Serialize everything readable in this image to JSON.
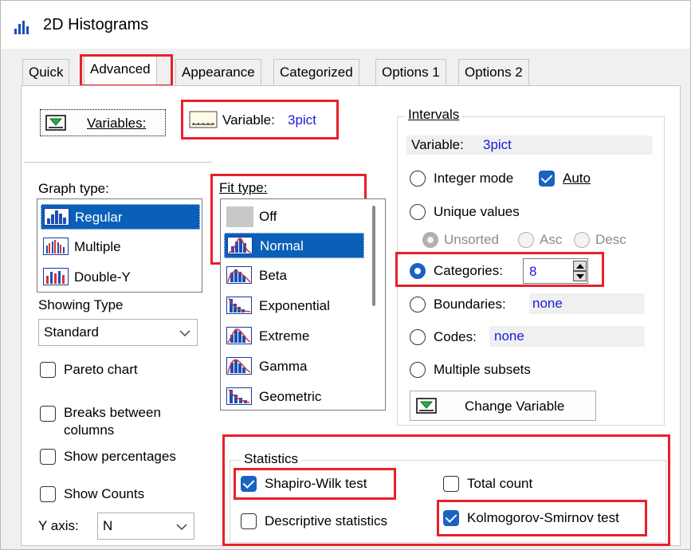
{
  "window": {
    "title": "2D Histograms",
    "icon": "histogram-app-icon"
  },
  "tabs": [
    "Quick",
    "Advanced",
    "Appearance",
    "Categorized",
    "Options 1",
    "Options 2"
  ],
  "active_tab": "Advanced",
  "variables_button": {
    "label": "Variables:",
    "icon": "green-arrow-icon"
  },
  "variable_display": {
    "label": "Variable:",
    "value": "3pict"
  },
  "graph_type": {
    "label": "Graph type:",
    "items": [
      {
        "label": "Regular",
        "selected": true
      },
      {
        "label": "Multiple",
        "selected": false
      },
      {
        "label": "Double-Y",
        "selected": false
      }
    ]
  },
  "showing_type": {
    "label": "Showing Type",
    "value": "Standard"
  },
  "checks_left": {
    "pareto": {
      "label": "Pareto chart",
      "checked": false
    },
    "breaks": {
      "label": "Breaks between",
      "label2": "columns",
      "checked": false
    },
    "percentages": {
      "label": "Show percentages",
      "checked": false
    },
    "counts": {
      "label": "Show Counts",
      "checked": false
    }
  },
  "y_axis": {
    "label": "Y axis:",
    "value": "N"
  },
  "fit_type": {
    "label": "Fit type:",
    "items": [
      {
        "label": "Off",
        "selected": false
      },
      {
        "label": "Normal",
        "selected": true
      },
      {
        "label": "Beta",
        "selected": false
      },
      {
        "label": "Exponential",
        "selected": false
      },
      {
        "label": "Extreme",
        "selected": false
      },
      {
        "label": "Gamma",
        "selected": false
      },
      {
        "label": "Geometric",
        "selected": false
      }
    ]
  },
  "intervals": {
    "title": "Intervals",
    "variable_label": "Variable:",
    "variable_value": "3pict",
    "integer_mode": "Integer mode",
    "auto": "Auto",
    "auto_checked": true,
    "unique_values": "Unique values",
    "unsorted": "Unsorted",
    "asc": "Asc",
    "desc": "Desc",
    "categories_label": "Categories:",
    "categories_value": "8",
    "categories_selected": true,
    "boundaries_label": "Boundaries:",
    "boundaries_value": "none",
    "codes_label": "Codes:",
    "codes_value": "none",
    "multiple_subsets": "Multiple subsets",
    "change_variable": "Change Variable"
  },
  "statistics": {
    "title": "Statistics",
    "shapiro": {
      "label": "Shapiro-Wilk test",
      "checked": true
    },
    "total_count": {
      "label": "Total count",
      "checked": false
    },
    "descriptive": {
      "label": "Descriptive statistics",
      "checked": false
    },
    "kolmogorov": {
      "label": "Kolmogorov-Smirnov test",
      "checked": true
    }
  },
  "colors": {
    "highlight": "#e8202a",
    "accent": "#1a62c4",
    "selection": "#0a5fb8",
    "value_text": "#1a1adb"
  }
}
